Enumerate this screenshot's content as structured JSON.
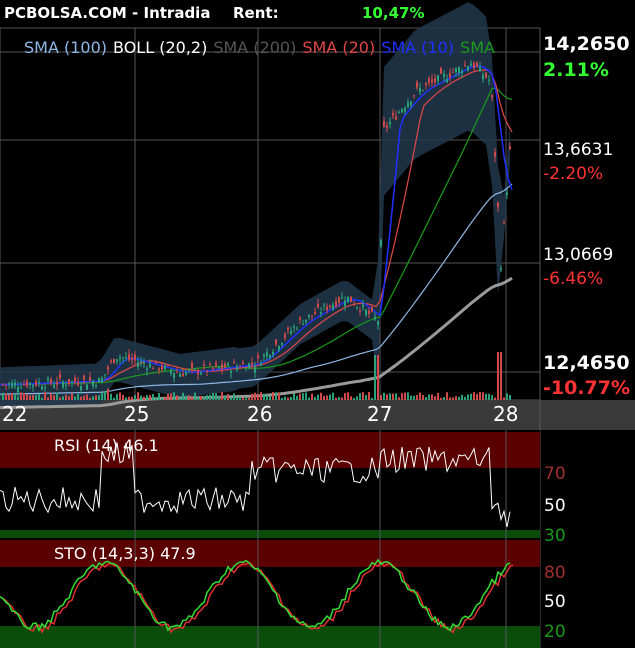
{
  "header": {
    "brand": "PCBOLSA.COM - Intradia",
    "rent_label": "Rent:",
    "rent_value": "10,47%"
  },
  "legend": [
    {
      "text": "SMA (100)",
      "color": "#8fb8e6"
    },
    {
      "text": "BOLL (20,2)",
      "color": "#ffffff"
    },
    {
      "text": "SMA (200)",
      "color": "#555555"
    },
    {
      "text": "SMA (20)",
      "color": "#e04848"
    },
    {
      "text": "SMA (10)",
      "color": "#2030ff"
    },
    {
      "text": "SMA",
      "color": "#1a9a1a"
    }
  ],
  "price_labels": [
    {
      "price": "14,2650",
      "pct": "2.11%",
      "pct_color": "#33ff33"
    },
    {
      "price": "13,6631",
      "pct": "-2.20%",
      "pct_color": "#ff3333"
    },
    {
      "price": "13,0669",
      "pct": "-6.46%",
      "pct_color": "#ff3333"
    },
    {
      "price": "12,4650",
      "pct": "-10.77%",
      "pct_color": "#ff3333"
    }
  ],
  "x_labels": [
    "22",
    "25",
    "26",
    "27",
    "28"
  ],
  "rsi": {
    "label": "RSI (14) 46.1",
    "levels": [
      "70",
      "50",
      "30"
    ]
  },
  "sto": {
    "label": "STO (14,3,3) 47.9",
    "levels": [
      "80",
      "50",
      "20"
    ]
  },
  "chart_data": {
    "type": "line",
    "price": {
      "ylim": [
        12.4,
        14.32
      ],
      "x_labels": [
        "22",
        "25",
        "26",
        "27",
        "28"
      ],
      "close_approx": [
        {
          "x": 0,
          "y": 12.47
        },
        {
          "x": 100,
          "y": 12.49
        },
        {
          "x": 115,
          "y": 12.62
        },
        {
          "x": 180,
          "y": 12.53
        },
        {
          "x": 255,
          "y": 12.58
        },
        {
          "x": 300,
          "y": 12.8
        },
        {
          "x": 345,
          "y": 12.93
        },
        {
          "x": 378,
          "y": 12.8
        },
        {
          "x": 383,
          "y": 13.8
        },
        {
          "x": 415,
          "y": 14.0
        },
        {
          "x": 470,
          "y": 14.15
        },
        {
          "x": 490,
          "y": 14.05
        },
        {
          "x": 500,
          "y": 13.1
        },
        {
          "x": 510,
          "y": 13.75
        }
      ],
      "series": [
        {
          "name": "SMA (200)"
        },
        {
          "name": "SMA (100)"
        },
        {
          "name": "SMA (20)"
        },
        {
          "name": "SMA (10)"
        },
        {
          "name": "SMA"
        },
        {
          "name": "BOLL (20,2)"
        }
      ]
    },
    "rsi": {
      "ylim": [
        30,
        80
      ],
      "levels": [
        30,
        50,
        70
      ],
      "last": 46.1
    },
    "sto": {
      "ylim": [
        20,
        85
      ],
      "levels": [
        20,
        50,
        80
      ],
      "last": 47.9
    }
  }
}
